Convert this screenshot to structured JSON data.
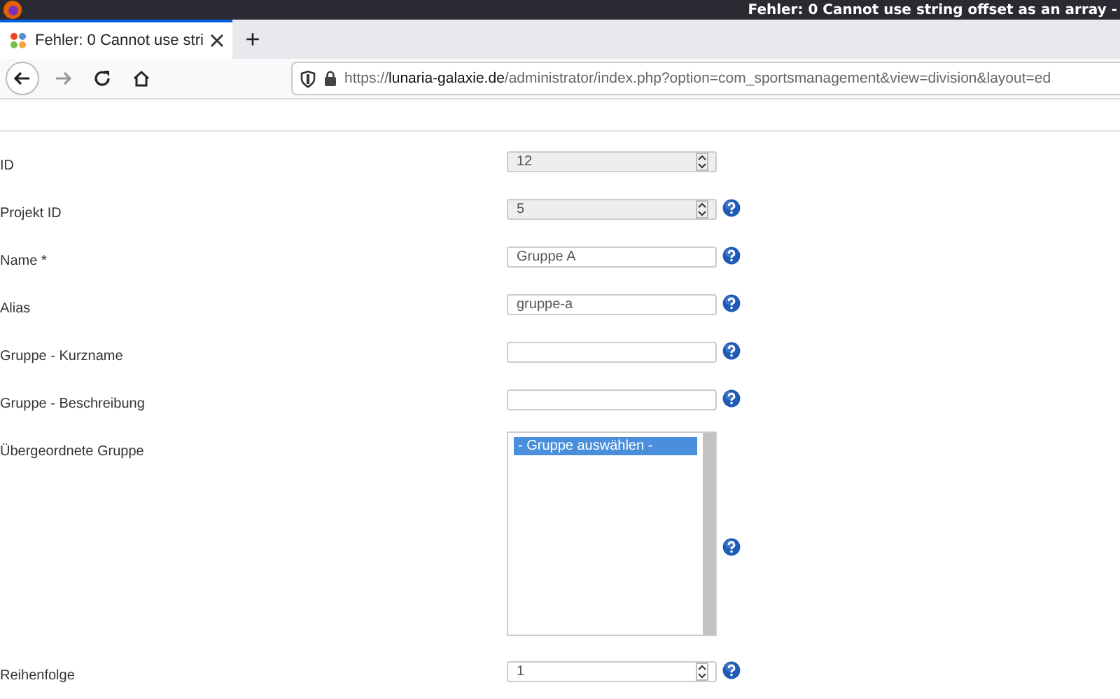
{
  "window": {
    "title": "Fehler: 0 Cannot use string offset as an array -"
  },
  "tabs": [
    {
      "label": "Fehler: 0 Cannot use stri",
      "selected": true
    }
  ],
  "new_tab": "+",
  "address_bar": {
    "scheme": "https://",
    "host": "lunaria-galaxie.de",
    "path": "/administrator/index.php?option=com_sportsmanagement&view=division&layout=ed"
  },
  "form": [
    {
      "label": "ID",
      "kind": "spinner",
      "value": "12",
      "disabled": true,
      "help": false
    },
    {
      "label": "Projekt ID",
      "kind": "spinner",
      "value": "5",
      "disabled": true,
      "help": true
    },
    {
      "label": "Name *",
      "kind": "text",
      "value": "Gruppe A",
      "disabled": false,
      "help": true
    },
    {
      "label": "Alias",
      "kind": "text",
      "value": "gruppe-a",
      "disabled": false,
      "help": true
    },
    {
      "label": "Gruppe - Kurzname",
      "kind": "text",
      "disabled": false,
      "help": true
    },
    {
      "label": "Gruppe - Beschreibung",
      "kind": "text",
      "disabled": false,
      "help": true
    },
    {
      "label": "Übergeordnete Gruppe",
      "kind": "listbox",
      "options": [
        {
          "label": "- Gruppe auswählen -",
          "selected": true
        }
      ],
      "help": true
    },
    {
      "label": "Reihenfolge",
      "kind": "spinner",
      "value": "1",
      "disabled": false,
      "help": true
    }
  ]
}
